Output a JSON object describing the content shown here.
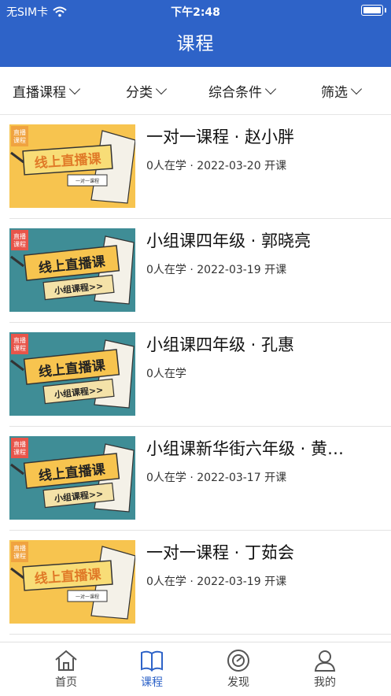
{
  "status_bar": {
    "carrier": "无SIM卡",
    "time": "下午2:48"
  },
  "header": {
    "title": "课程"
  },
  "filters": [
    {
      "label": "直播课程"
    },
    {
      "label": "分类"
    },
    {
      "label": "综合条件"
    },
    {
      "label": "筛选"
    }
  ],
  "thumb_text": {
    "badge": "直播\n课程",
    "main": "线上直播课",
    "sub_one": "一对一课程",
    "sub_group": "小组课程>>"
  },
  "courses": [
    {
      "name": "一对一课程 · 赵小胖",
      "meta": "0人在学 · 2022-03-20 开课",
      "thumb": "yellow"
    },
    {
      "name": "小组课四年级 · 郭晓亮",
      "meta": "0人在学 · 2022-03-19 开课",
      "thumb": "teal"
    },
    {
      "name": "小组课四年级 · 孔惠",
      "meta": "0人在学",
      "thumb": "teal"
    },
    {
      "name": "小组课新华街六年级 · 黄…",
      "meta": "0人在学 · 2022-03-17 开课",
      "thumb": "teal"
    },
    {
      "name": "一对一课程 · 丁茹会",
      "meta": "0人在学 · 2022-03-19 开课",
      "thumb": "yellow"
    }
  ],
  "tabs": [
    {
      "label": "首页",
      "icon": "home-icon"
    },
    {
      "label": "课程",
      "icon": "book-icon",
      "active": true
    },
    {
      "label": "发现",
      "icon": "compass-icon"
    },
    {
      "label": "我的",
      "icon": "user-icon"
    }
  ],
  "colors": {
    "primary": "#2e63c8",
    "thumb_yellow": "#f7c44f",
    "thumb_teal": "#3f8d96"
  }
}
